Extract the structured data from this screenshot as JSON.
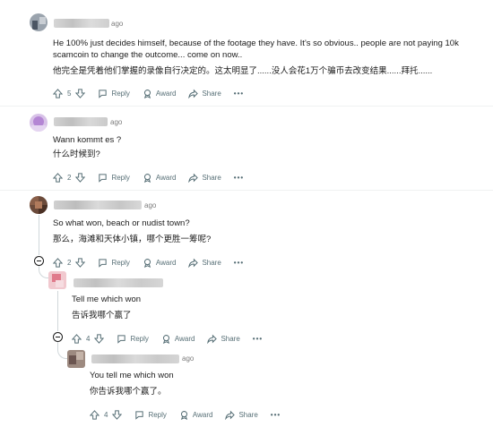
{
  "comments": [
    {
      "ago": "ago",
      "en": [
        "He 100% just decides himself, because of the footage they have. It's so obvious.. people are not paying 10k",
        "scamcoin to change the outcome... come on now.."
      ],
      "zh": "他完全是凭着他们掌握的录像自行决定的。这太明显了......没人会花1万个骗币去改变结果......拜托......",
      "votes": "5"
    },
    {
      "ago": "ago",
      "en": [
        "Wann kommt es ?"
      ],
      "zh": "什么时候到?",
      "votes": "2"
    },
    {
      "ago": "ago",
      "en": [
        "So what won, beach or nudist town?"
      ],
      "zh": "那么，海滩和天体小镇，哪个更胜一筹呢?",
      "votes": "2"
    },
    {
      "ago": "",
      "en": [
        "Tell me which won"
      ],
      "zh": "告诉我哪个赢了",
      "votes": "4"
    },
    {
      "ago": "ago",
      "en": [
        "You tell me which won"
      ],
      "zh": "你告诉我哪个赢了。",
      "votes": "4"
    }
  ],
  "actions": {
    "reply": "Reply",
    "award": "Award",
    "share": "Share",
    "more": "•••"
  },
  "icons": [
    "upvote-icon",
    "downvote-icon",
    "reply-icon",
    "award-icon",
    "share-icon",
    "more-icon",
    "collapse-icon"
  ]
}
